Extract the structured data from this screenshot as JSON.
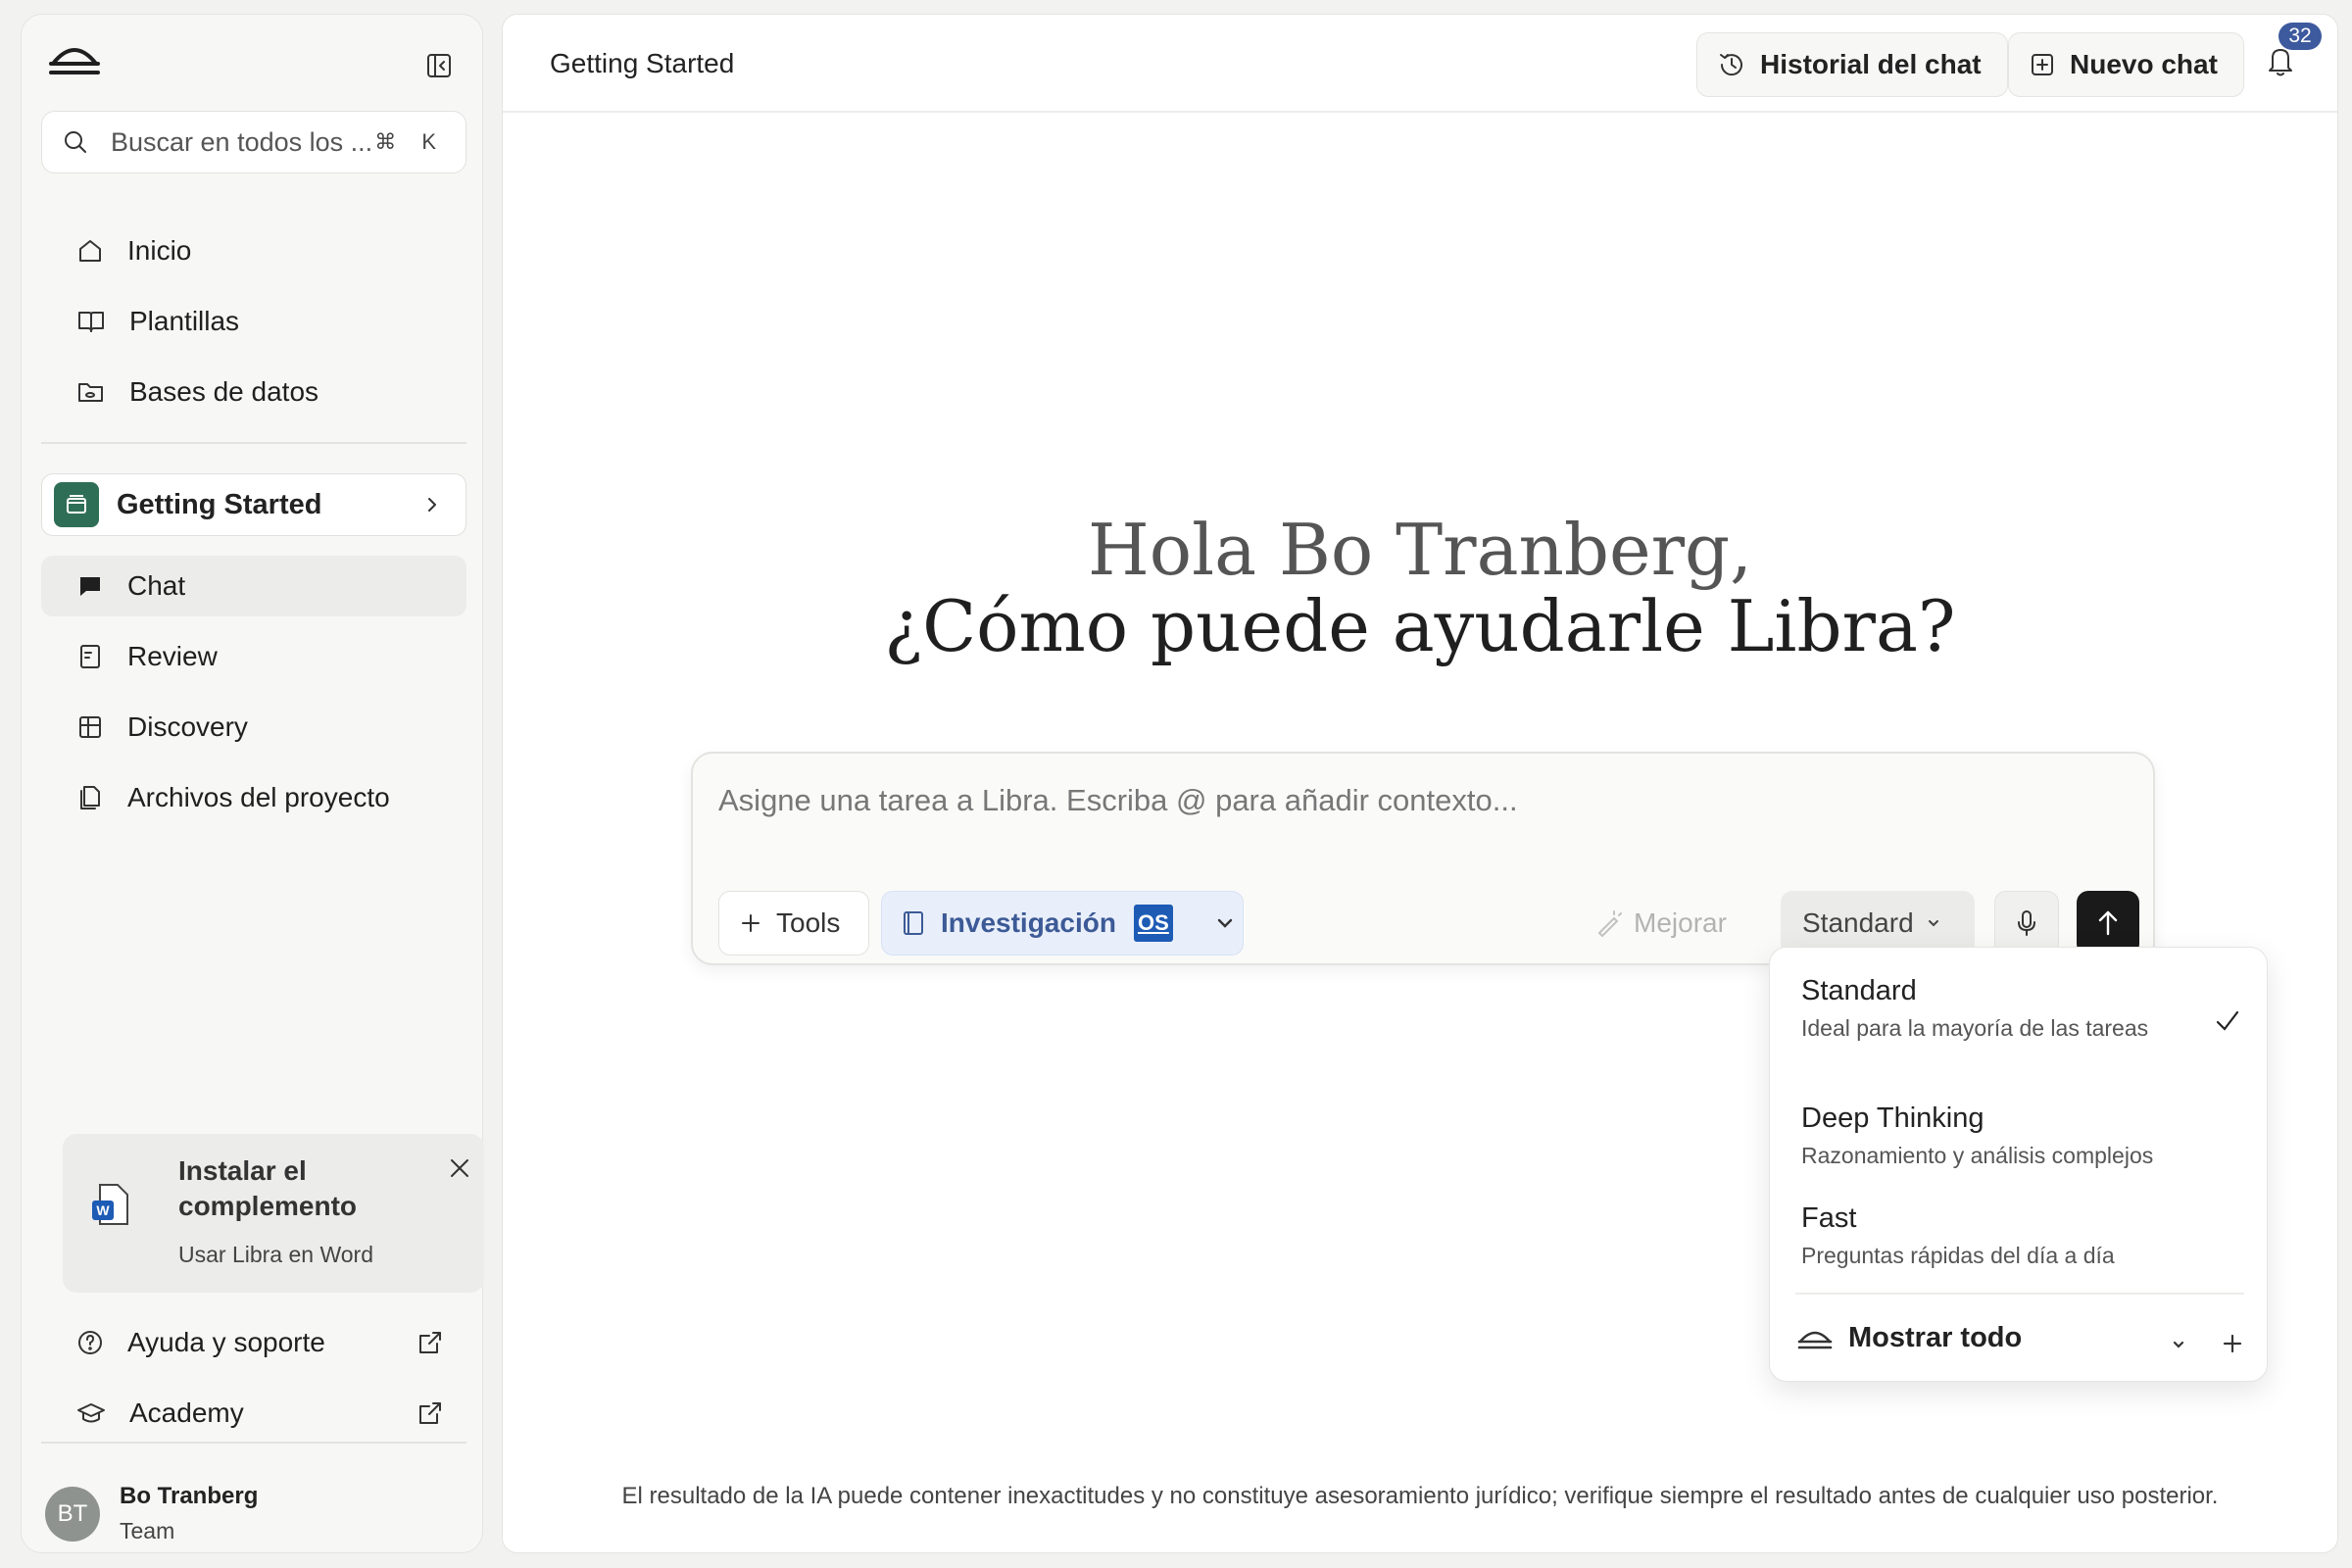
{
  "sidebar": {
    "search_placeholder": "Buscar en todos los ...",
    "search_shortcut": "⌘ K",
    "nav": [
      {
        "label": "Inicio",
        "icon": "home-icon"
      },
      {
        "label": "Plantillas",
        "icon": "book-icon"
      },
      {
        "label": "Bases de datos",
        "icon": "database-folder-icon"
      }
    ],
    "project": {
      "label": "Getting Started",
      "color": "#2f6e56"
    },
    "project_nav": [
      {
        "label": "Chat",
        "icon": "chat-icon",
        "active": true
      },
      {
        "label": "Review",
        "icon": "review-icon"
      },
      {
        "label": "Discovery",
        "icon": "table-icon"
      },
      {
        "label": "Archivos del proyecto",
        "icon": "files-icon"
      }
    ],
    "install_card": {
      "title": "Instalar el complemento",
      "subtitle": "Usar Libra en Word"
    },
    "help": {
      "label": "Ayuda y soporte"
    },
    "academy": {
      "label": "Academy"
    },
    "user": {
      "initials": "BT",
      "name": "Bo Tranberg",
      "team": "Team"
    }
  },
  "header": {
    "title": "Getting Started",
    "history_label": "Historial del chat",
    "new_chat_label": "Nuevo chat",
    "notification_count": "32"
  },
  "main": {
    "greeting_line1": "Hola Bo Tranberg,",
    "greeting_line2": "¿Cómo puede ayudarle Libra?",
    "composer": {
      "placeholder": "Asigne una tarea a Libra. Escriba @ para añadir contexto...",
      "tools_label": "Tools",
      "source_label": "Investigación",
      "source_badge": "OS",
      "improve_label": "Mejorar",
      "mode_label": "Standard"
    },
    "disclaimer": "El resultado de la IA puede contener inexactitudes y no constituye asesoramiento jurídico; verifique siempre el resultado antes de cualquier uso posterior."
  },
  "mode_menu": {
    "options": [
      {
        "title": "Standard",
        "desc": "Ideal para la mayoría de las tareas",
        "selected": true
      },
      {
        "title": "Deep Thinking",
        "desc": "Razonamiento y análisis complejos"
      },
      {
        "title": "Fast",
        "desc": "Preguntas rápidas del día a día"
      }
    ],
    "show_all_label": "Mostrar todo"
  },
  "colors": {
    "accent": "#3d5a9e",
    "project_badge": "#2f6e56",
    "send_button": "#1a1a1a"
  }
}
